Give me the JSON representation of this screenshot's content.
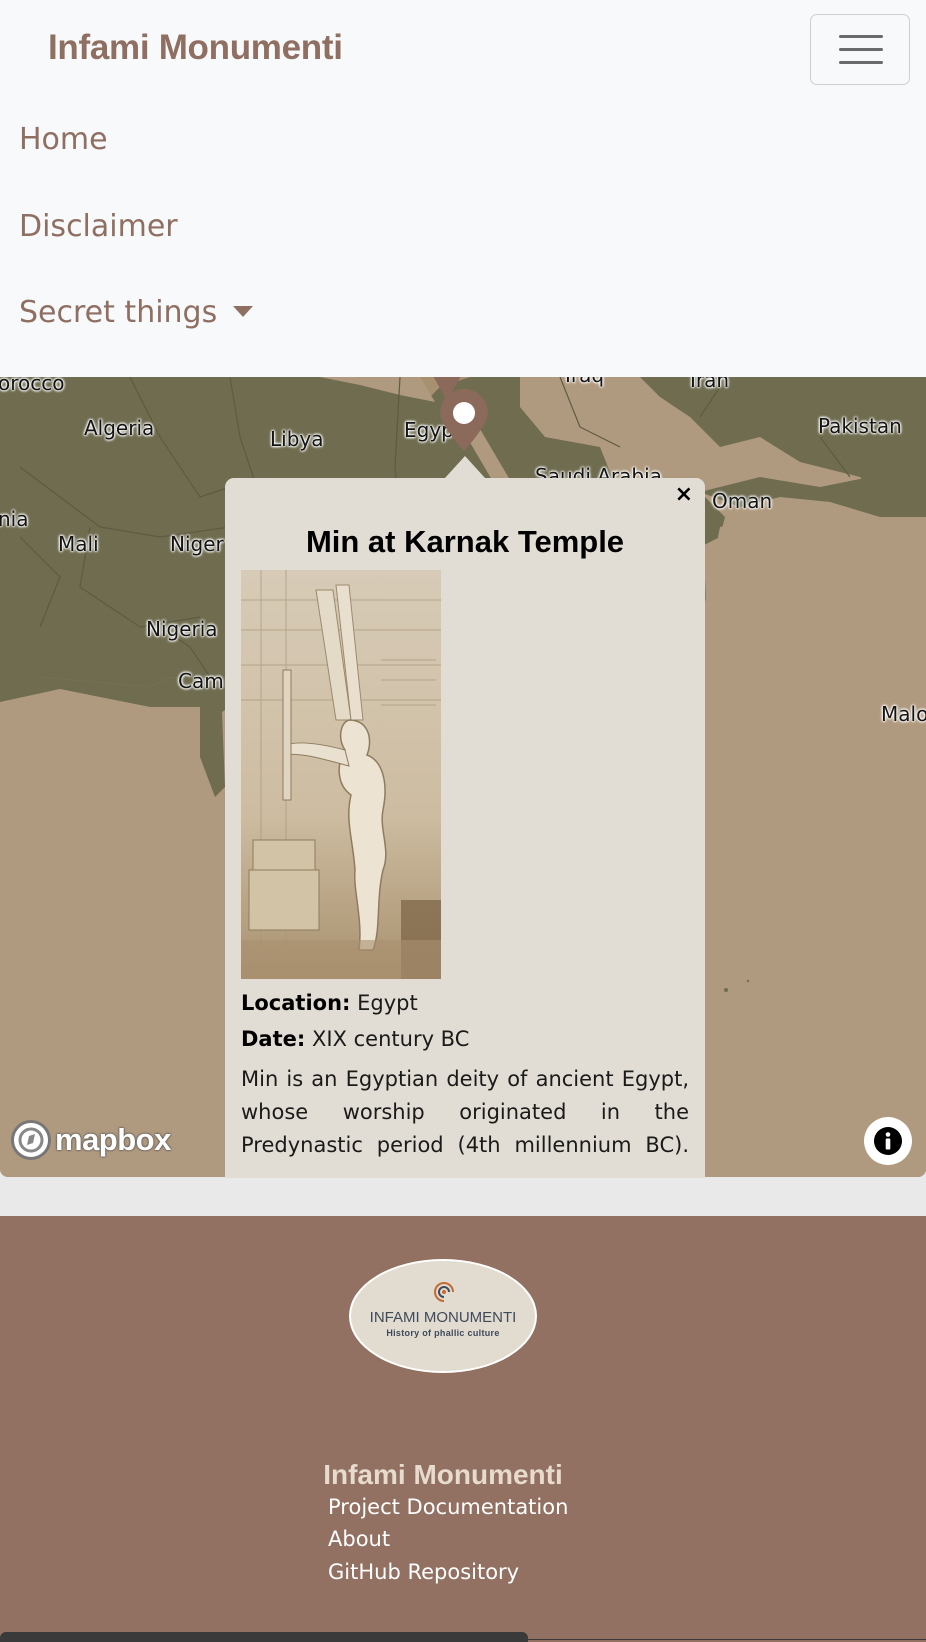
{
  "navbar": {
    "brand": "Infami Monumenti",
    "links": [
      "Home",
      "Disclaimer"
    ],
    "dropdown_label": "Secret things"
  },
  "map": {
    "labels": [
      "orocco",
      "Algeria",
      "Libya",
      "Egypt",
      "Iraq",
      "Iran",
      "Pakistan",
      "Saudi Arabia",
      "Oman",
      "nia",
      "Mali",
      "Niger",
      "Nigeria",
      "Cam",
      "Malo"
    ],
    "attribution_logo": "mapbox",
    "colors": {
      "land": "#6f6c4f",
      "water": "#b09a7f",
      "marker": "#8b6a5c"
    }
  },
  "popup": {
    "title": "Min at Karnak Temple",
    "close_symbol": "×",
    "location_label": "Location:",
    "location_value": "Egypt",
    "date_label": "Date:",
    "date_value": "XIX century BC",
    "description": "Min is an Egyptian deity of ancient Egypt, whose worship originated in the Predynastic period (4th millennium BC)."
  },
  "footer": {
    "logo_name": "INFAMI MONUMENTI",
    "logo_tagline": "History of phallic culture",
    "title": "Infami Monumenti",
    "links": [
      "Project Documentation",
      "About",
      "GitHub Repository"
    ],
    "colors": {
      "background": "#927062"
    }
  }
}
